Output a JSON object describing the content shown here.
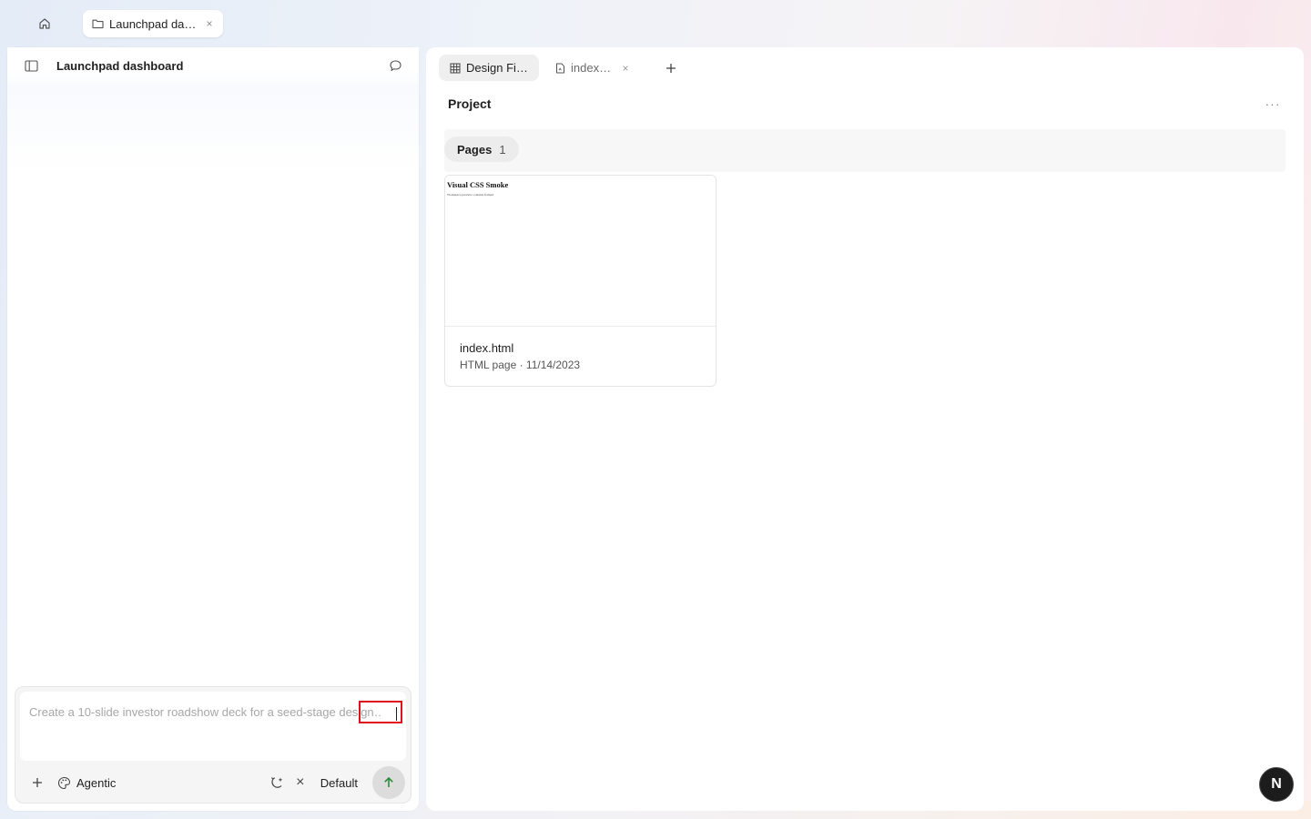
{
  "topbar": {
    "home_icon": "home-icon",
    "tab": {
      "label": "Launchpad dashboard",
      "close": "×"
    }
  },
  "left": {
    "title": "Launchpad dashboard",
    "composer": {
      "placeholder": "Create a 10-slide investor roadshow deck for a seed-stage design…",
      "mode_label": "Agentic",
      "close_label": "×",
      "model_label": "Default"
    }
  },
  "right": {
    "tabs": [
      {
        "label": "Design Files",
        "icon": "grid-icon"
      },
      {
        "label": "index.html",
        "icon": "file-icon",
        "close": "×"
      }
    ],
    "project_title": "Project",
    "more_label": "···",
    "pages": {
      "label": "Pages",
      "count": "1"
    },
    "card": {
      "thumb_title": "Visual CSS Smoke",
      "thumb_subtitle": "Workspace preview contains framed",
      "name": "index.html",
      "meta": "HTML page · 11/14/2023"
    }
  },
  "avatar": {
    "initial": "N"
  },
  "colors": {
    "accent_focus": "#e0101f",
    "send_arrow": "#2e8b3a",
    "avatar_bg": "#1c1c1c"
  }
}
